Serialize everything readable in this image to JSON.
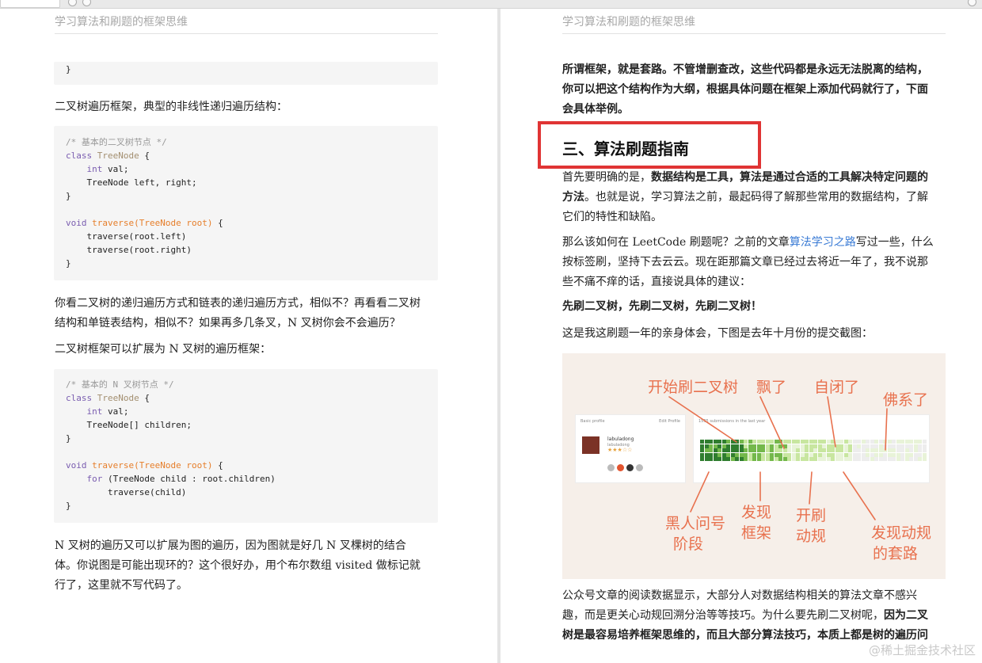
{
  "browser": {
    "tabs_hint": ""
  },
  "left_page": {
    "header": "学习算法和刷题的框架思维",
    "code_top_line": "}",
    "para1": "二叉树遍历框架，典型的非线性递归遍历结构：",
    "code1": {
      "comment": "/* 基本的二叉树节点 */",
      "class_kw": "class",
      "class_name": "TreeNode",
      "open": " {",
      "int_kw": "int",
      "field1": " val;",
      "field2": "TreeNode left, right;",
      "close": "}",
      "void_kw": "void",
      "fn_name": "traverse(TreeNode root)",
      "fn_open": " {",
      "call1": "traverse(root.left)",
      "call2": "traverse(root.right)",
      "fn_close": "}"
    },
    "para2_line1": "你看二叉树的递归遍历方式和链表的递归遍历方式，相似不？再看看二叉树",
    "para2_line2": "结构和单链表结构，相似不？如果再多几条叉，N 叉树你会不会遍历？",
    "para3": "二叉树框架可以扩展为 N 叉树的遍历框架：",
    "code2": {
      "comment": "/* 基本的 N 叉树节点 */",
      "class_kw": "class",
      "class_name": "TreeNode",
      "open": " {",
      "int_kw": "int",
      "field1": " val;",
      "field2": "TreeNode[] children;",
      "close": "}",
      "void_kw": "void",
      "fn_name": "traverse(TreeNode root)",
      "fn_open": " {",
      "for_kw": "for",
      "for_rest": " (TreeNode child : root.children)",
      "call1": "traverse(child)",
      "fn_close": "}"
    },
    "para4_line1": "N 叉树的遍历又可以扩展为图的遍历，因为图就是好几 N 叉棵树的结合",
    "para4_line2": "体。你说图是可能出现环的？这个很好办，用个布尔数组 visited 做标记就",
    "para4_line3": "行了，这里就不写代码了。"
  },
  "right_page": {
    "header": "学习算法和刷题的框架思维",
    "intro_line1": "所谓框架，就是套路。不管增删查改，这些代码都是永远无法脱离的结构，",
    "intro_line2": "你可以把这个结构作为大纲，根据具体问题在框架上添加代码就行了，下面",
    "intro_line3": "会具体举例。",
    "section_title": "三、算法刷题指南",
    "p1_l1_a": "首先要明确的是，",
    "p1_l1_b": "数据结构是工具，算法是通过合适的工具解决特定问题的",
    "p1_l2_a": "方法",
    "p1_l2_b": "。也就是说，学习算法之前，最起码得了解那些常用的数据结构，了解",
    "p1_l3": "它们的特性和缺陷。",
    "p2_l1_a": "那么该如何在 LeetCode 刷题呢？之前的文章",
    "p2_l1_link": "算法学习之路",
    "p2_l1_b": "写过一些，什么",
    "p2_l2": "按标签刷，坚持下去云云。现在距那篇文章已经过去将近一年了，我不说那",
    "p2_l3": "些不痛不痒的话，直接说具体的建议：",
    "p3": "先刷二叉树，先刷二叉树，先刷二叉树！",
    "p4": "这是我这刷题一年的亲身体会，下图是去年十月份的提交截图：",
    "figure": {
      "basic_profile": "Basic profile",
      "edit_profile": "Edit Profile",
      "submissions": "1535 submissions in the last year",
      "username": "labuladong",
      "user_sub": "labuladong",
      "stars": "★★★☆☆",
      "ann1": "开始刷二叉树",
      "ann2": "飘了",
      "ann3": "自闭了",
      "ann4": "佛系了",
      "ann5": "黑人问号",
      "ann5b": "阶段",
      "ann6": "发现",
      "ann6b": "框架",
      "ann7": "开刷",
      "ann7b": "动规",
      "ann8": "发现动规",
      "ann8b": "的套路",
      "colors": {
        "dark": "#2f7d2f",
        "mid": "#74b84b",
        "light": "#c8e6a0",
        "pale": "#e8f3d8",
        "ink": "#e8714e"
      }
    },
    "p5_l1": "公众号文章的阅读数据显示，大部分人对数据结构相关的算法文章不感兴",
    "p5_l2_a": "趣，而是更关心动规回溯分治等等技巧。为什么要先刷二叉树呢，",
    "p5_l2_b": "因为二叉",
    "p5_l3": "树是最容易培养框架思维的，而且大部分算法技巧，本质上都是树的遍历问"
  },
  "watermark": "@稀土掘金技术社区"
}
